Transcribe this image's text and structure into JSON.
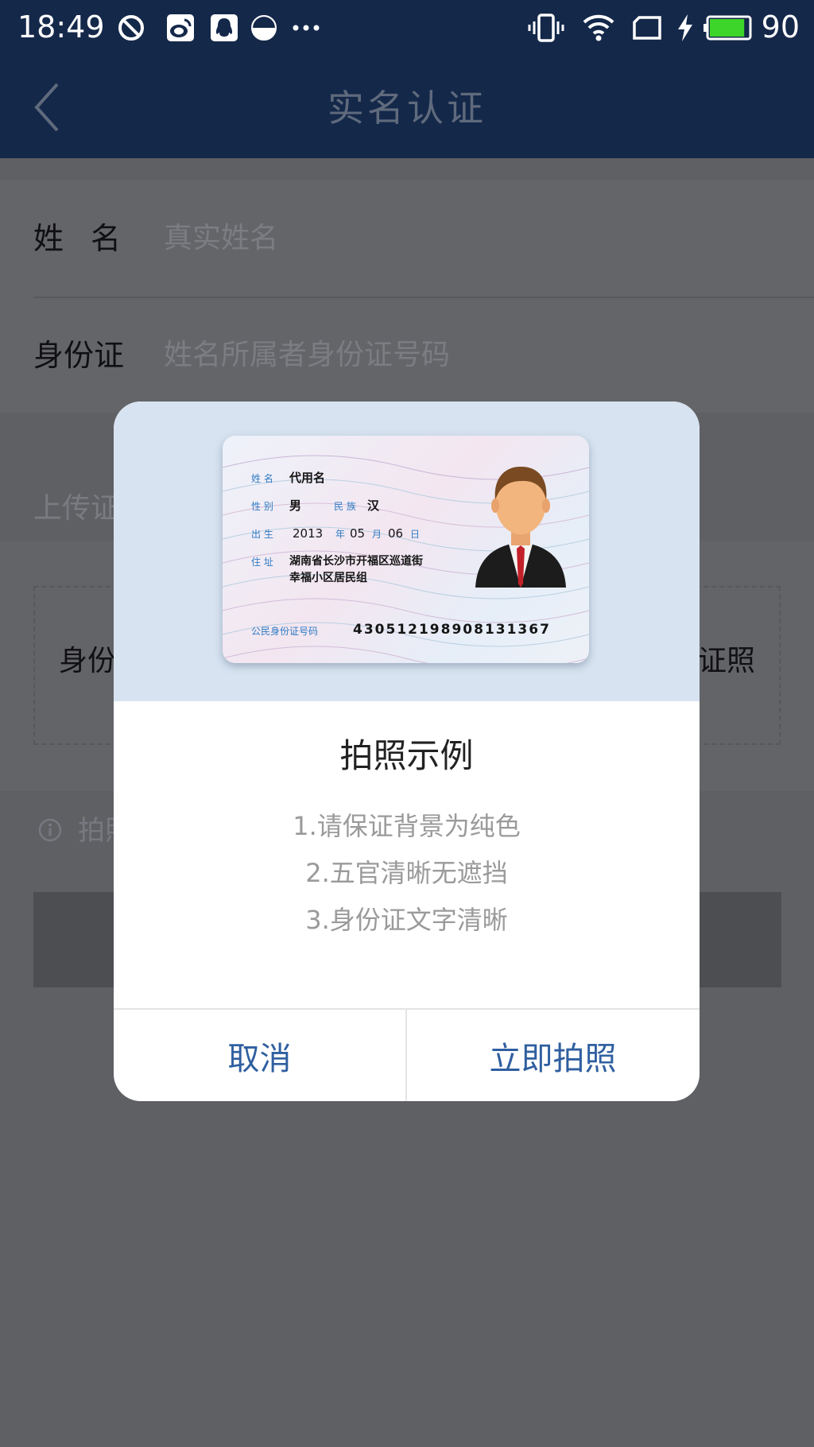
{
  "status_bar": {
    "time": "18:49",
    "battery_level": "90",
    "left_icons": [
      "blocked-circle-icon",
      "weibo-icon",
      "qq-icon",
      "half-moon-icon",
      "more-dots-icon"
    ],
    "right_icons": [
      "vibrate-icon",
      "wifi-icon",
      "sim-card-icon",
      "charging-bolt-icon",
      "battery-icon"
    ]
  },
  "header": {
    "title": "实名认证",
    "back_icon": "chevron-left-icon"
  },
  "form": {
    "name_label": "姓名",
    "name_placeholder": "真实姓名",
    "id_label": "身份证",
    "id_placeholder": "姓名所属者身份证号码"
  },
  "upload": {
    "title_partial": "上传证",
    "front_label_partial": "身份",
    "back_label_partial": "证照"
  },
  "tip": {
    "text_partial": "拍照",
    "icon": "info-circle-icon"
  },
  "modal": {
    "title": "拍照示例",
    "tips": [
      "1.请保证背景为纯色",
      "2.五官清晰无遮挡",
      "3.身份证文字清晰"
    ],
    "cancel_label": "取消",
    "confirm_label": "立即拍照",
    "sample_card": {
      "name_field": "姓 名",
      "name_value": "代用名",
      "sex_field": "性 别",
      "sex_value": "男",
      "ethnicity_field": "民 族",
      "ethnicity_value": "汉",
      "birth_field": "出 生",
      "birth_year": "2013",
      "year_unit": "年",
      "birth_month": "05",
      "month_unit": "月",
      "birth_day": "06",
      "day_unit": "日",
      "address_field": "住 址",
      "address_line1": "湖南省长沙市开福区巡道街",
      "address_line2": "幸福小区居民组",
      "id_field": "公民身份证号码",
      "id_number": "430512198908131367"
    }
  },
  "colors": {
    "header_bg": "#14284a",
    "overlay": "#5f6064",
    "modal_button_text": "#2f5fa0",
    "battery_fill": "#3ed52b"
  }
}
